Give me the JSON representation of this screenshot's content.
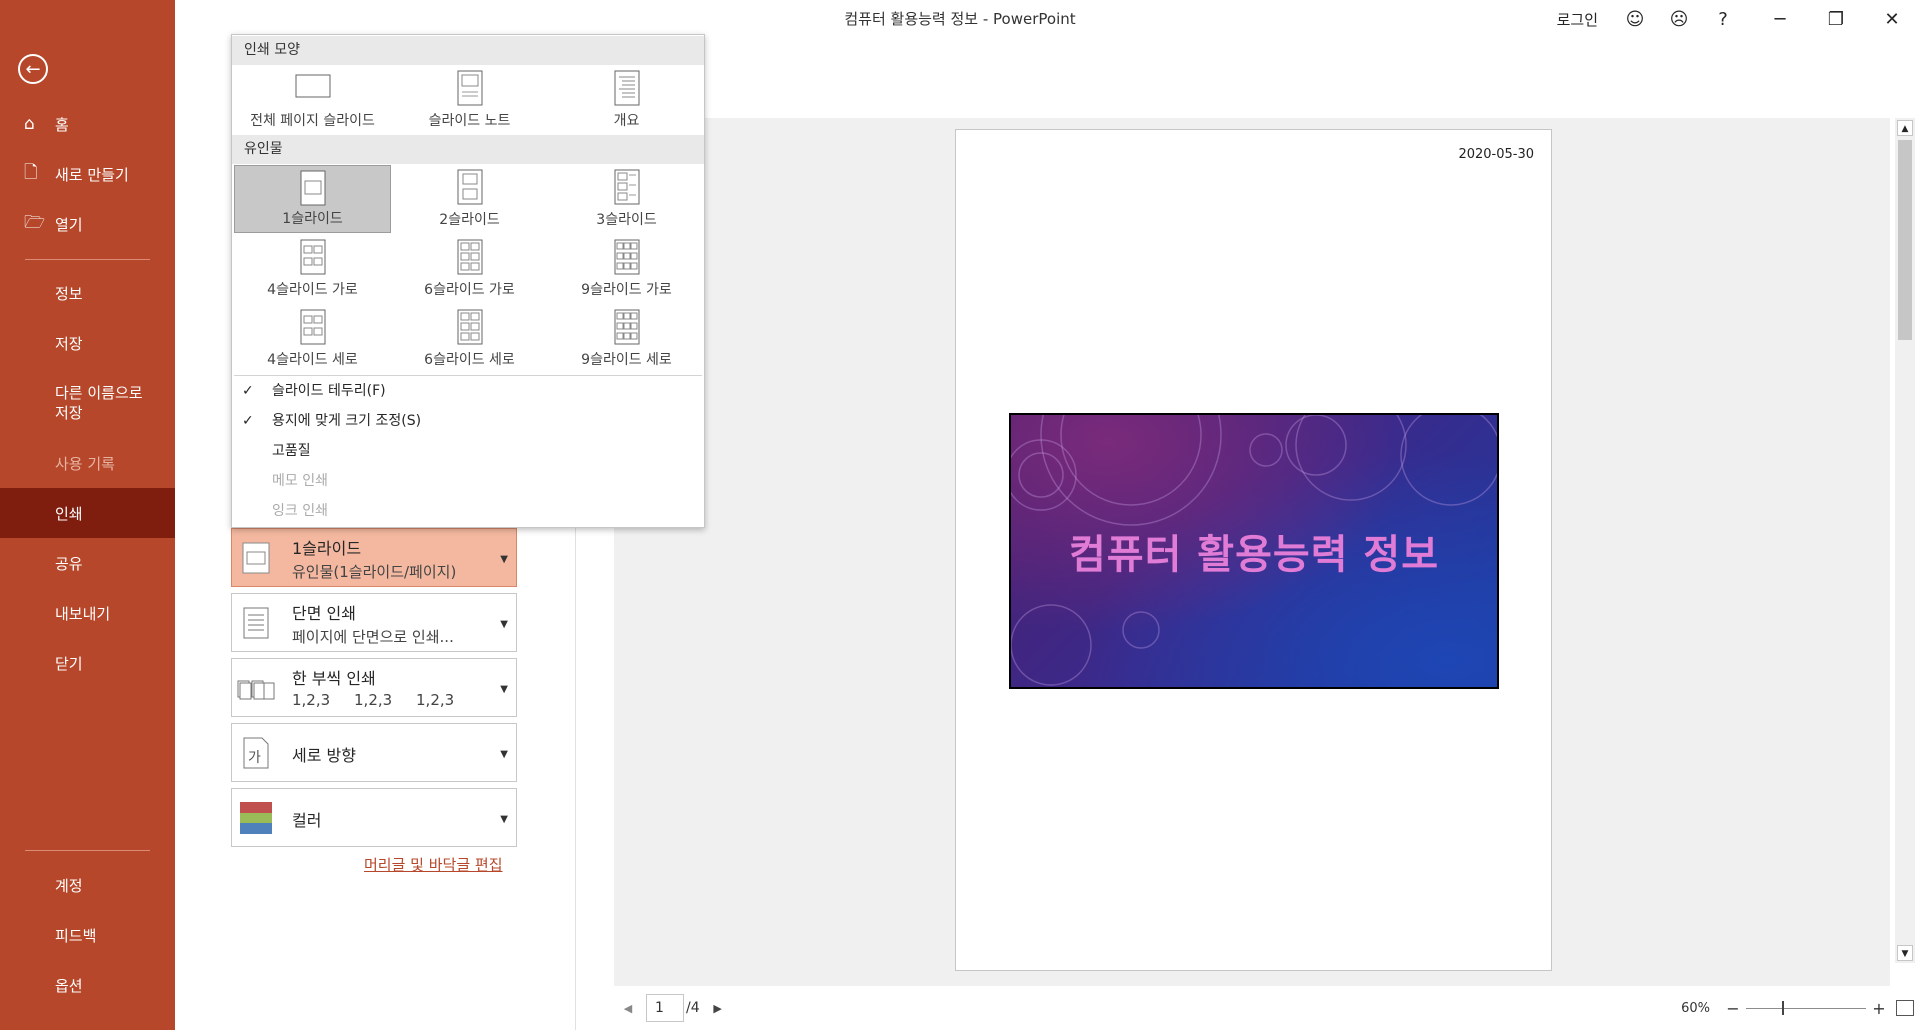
{
  "window": {
    "title": "컴퓨터 활용능력 정보  -  PowerPoint",
    "login_label": "로그인",
    "help_label": "?"
  },
  "sidebar": {
    "items": [
      {
        "label": "홈",
        "icon": "home-icon"
      },
      {
        "label": "새로 만들기",
        "icon": "new-file-icon"
      },
      {
        "label": "열기",
        "icon": "open-folder-icon"
      },
      {
        "label": "정보"
      },
      {
        "label": "저장"
      },
      {
        "label": "다른 이름으로\n저장"
      },
      {
        "label": "사용 기록",
        "disabled": true
      },
      {
        "label": "인쇄",
        "active": true
      },
      {
        "label": "공유"
      },
      {
        "label": "내보내기"
      },
      {
        "label": "닫기"
      },
      {
        "label": "계정"
      },
      {
        "label": "피드백"
      },
      {
        "label": "옵션"
      }
    ]
  },
  "layout_popup": {
    "section1_header": "인쇄 모양",
    "print_layouts": [
      "전체 페이지 슬라이드",
      "슬라이드 노트",
      "개요"
    ],
    "section2_header": "유인물",
    "handouts": [
      "1슬라이드",
      "2슬라이드",
      "3슬라이드",
      "4슬라이드 가로",
      "6슬라이드 가로",
      "9슬라이드 가로",
      "4슬라이드 세로",
      "6슬라이드 세로",
      "9슬라이드 세로"
    ],
    "selected_handout": "1슬라이드",
    "options": [
      {
        "label": "슬라이드 테두리(F)",
        "checked": true,
        "disabled": false
      },
      {
        "label": "용지에 맞게 크기 조정(S)",
        "checked": true,
        "disabled": false
      },
      {
        "label": "고품질",
        "checked": false,
        "disabled": false
      },
      {
        "label": "메모 인쇄",
        "checked": false,
        "disabled": true
      },
      {
        "label": "잉크 인쇄",
        "checked": false,
        "disabled": true
      }
    ]
  },
  "settings": {
    "layout": {
      "line1": "1슬라이드",
      "line2": "유인물(1슬라이드/페이지)"
    },
    "sides": {
      "line1": "단면 인쇄",
      "line2": "페이지에 단면으로 인쇄..."
    },
    "collate": {
      "line1": "한 부씩 인쇄",
      "line2": "1,2,3     1,2,3     1,2,3"
    },
    "orientation": {
      "line1": "세로 방향"
    },
    "color": {
      "line1": "컬러",
      "swatches": [
        "#c0504d",
        "#9bbb59",
        "#4f81bd"
      ]
    },
    "header_footer_link": "머리글 및 바닥글 편집"
  },
  "preview": {
    "date": "2020-05-30",
    "slide_title": "컴퓨터 활용능력 정보",
    "slide_title_color": "#e07bd6"
  },
  "pager": {
    "current": "1",
    "total": "/4"
  },
  "zoom": {
    "level": "60%"
  },
  "colors": {
    "accent": "#b7472a",
    "active_nav": "#7f1d0e",
    "selected_setting": "#f4b8a0"
  }
}
